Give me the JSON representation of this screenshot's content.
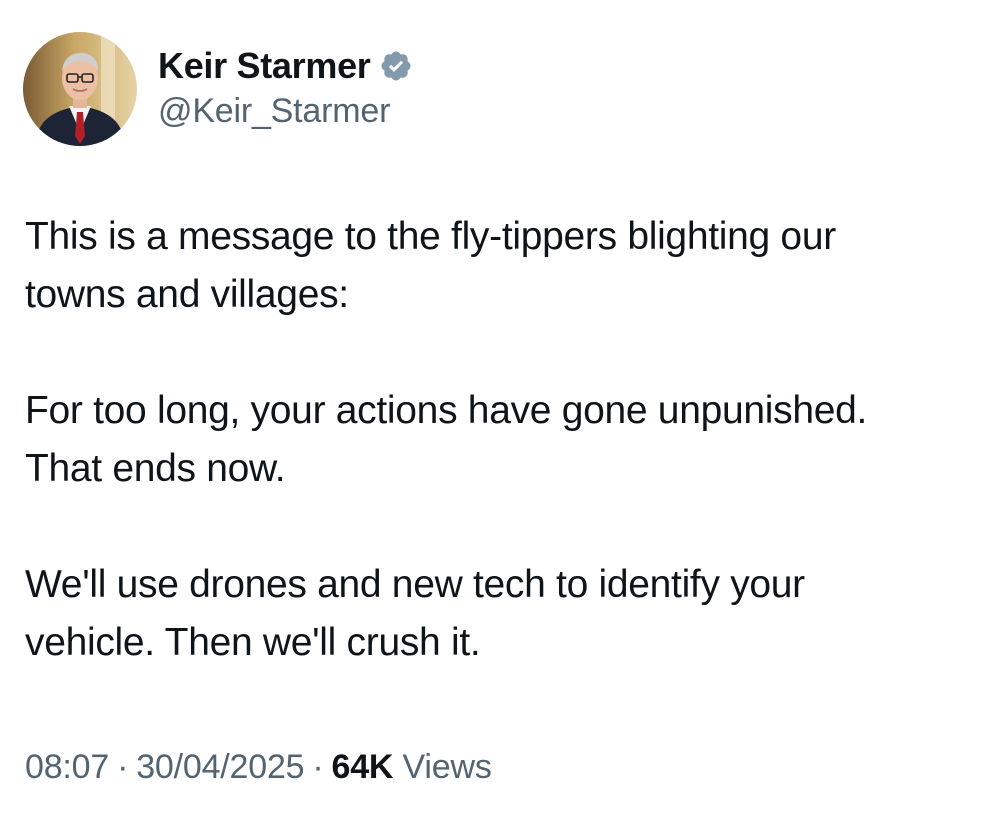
{
  "author": {
    "display_name": "Keir Starmer",
    "handle": "@Keir_Starmer",
    "verified_badge": "verified-badge-icon",
    "verified_color": "#829aab"
  },
  "tweet": {
    "paragraphs": [
      [
        "This is a message to the fly-tippers blighting our",
        "towns and villages:"
      ],
      [
        "For too long, your actions have gone unpunished.",
        "That ends now."
      ],
      [
        "We'll use drones and new tech to identify your",
        "vehicle. Then we'll crush it."
      ]
    ]
  },
  "meta": {
    "time": "08:07",
    "separator": "·",
    "date": "30/04/2025",
    "views_count": "64K",
    "views_label": "Views"
  },
  "colors": {
    "text_primary": "#0f1419",
    "text_secondary": "#536471",
    "background": "#ffffff"
  }
}
